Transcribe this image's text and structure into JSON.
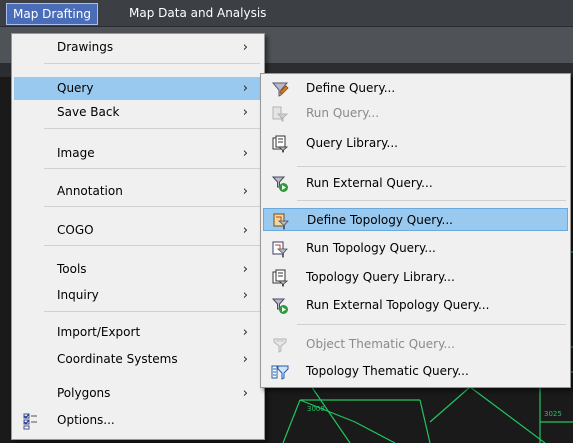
{
  "menubar": {
    "items": [
      {
        "label": "Map Drafting"
      },
      {
        "label": "Map Data and Analysis"
      }
    ]
  },
  "main_menu": {
    "items": [
      {
        "label": "Drawings",
        "has_submenu": true
      },
      {
        "label": "Query",
        "has_submenu": true,
        "highlighted": true
      },
      {
        "label": "Save Back",
        "has_submenu": true
      },
      {
        "label": "Image",
        "has_submenu": true
      },
      {
        "label": "Annotation",
        "has_submenu": true
      },
      {
        "label": "COGO",
        "has_submenu": true
      },
      {
        "label": "Tools",
        "has_submenu": true
      },
      {
        "label": "Inquiry",
        "has_submenu": true
      },
      {
        "label": "Import/Export",
        "has_submenu": true
      },
      {
        "label": "Coordinate Systems",
        "has_submenu": true
      },
      {
        "label": "Polygons",
        "has_submenu": true
      },
      {
        "label": "Options...",
        "icon": "options-checklist-icon"
      }
    ],
    "arrow_glyph": "›"
  },
  "sub_menu": {
    "items": [
      {
        "label": "Define Query...",
        "icon": "define-query-icon"
      },
      {
        "label": "Run Query...",
        "icon": "run-query-icon",
        "disabled": true
      },
      {
        "label": "Query Library...",
        "icon": "query-library-icon"
      },
      {
        "label": "Run External Query...",
        "icon": "run-external-query-icon"
      },
      {
        "label": "Define Topology Query...",
        "icon": "define-topology-query-icon",
        "highlighted": true
      },
      {
        "label": "Run Topology Query...",
        "icon": "run-topology-query-icon"
      },
      {
        "label": "Topology Query Library...",
        "icon": "topology-query-library-icon"
      },
      {
        "label": "Run External Topology Query...",
        "icon": "run-external-topology-query-icon"
      },
      {
        "label": "Object Thematic Query...",
        "icon": "object-thematic-query-icon",
        "disabled": true
      },
      {
        "label": "Topology Thematic Query...",
        "icon": "topology-thematic-query-icon"
      }
    ]
  },
  "drawing": {
    "labels": [
      "3008",
      "3025",
      "3"
    ]
  },
  "colors": {
    "highlight": "#99c9ef",
    "menu_bg": "#f0f0f0",
    "drawing_lines": "#22c55e",
    "menubar_active": "#4b6db8"
  }
}
